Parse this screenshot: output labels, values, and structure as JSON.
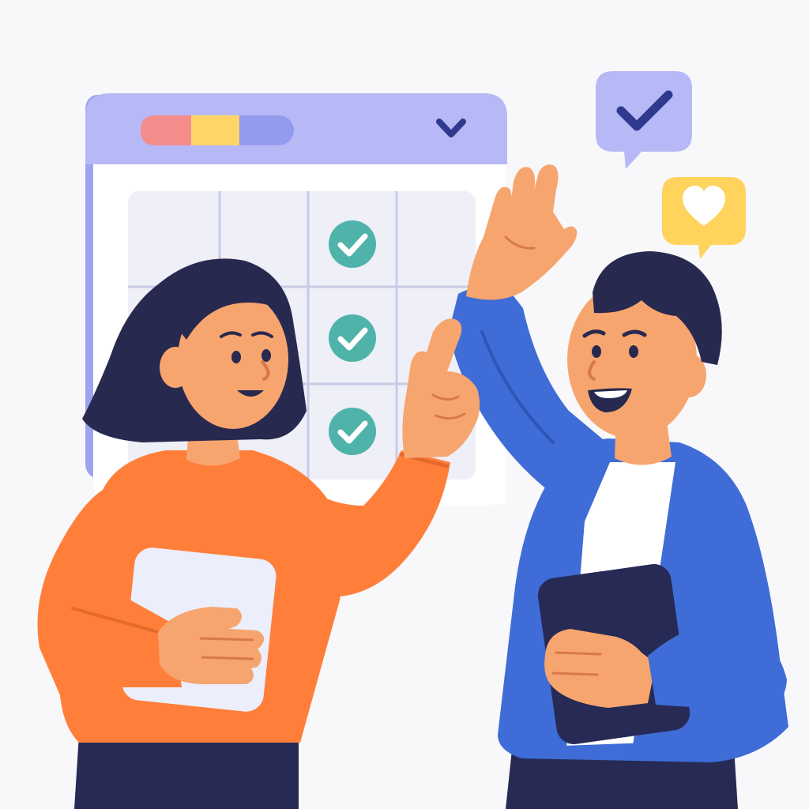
{
  "colors": {
    "background": "#f8f8fb",
    "window_frame": "#b6b8f5",
    "window_header": "#b7b9f6",
    "grid_panel": "#eeeff7",
    "grid_line": "#c9cbe6",
    "check_badge": "#4fb3aa",
    "pill_red": "#f48c8c",
    "pill_yellow": "#ffd56a",
    "pill_blue": "#949bef",
    "bubble_purple": "#b7b9f6",
    "bubble_check": "#2f3a8f",
    "bubble_yellow": "#ffd35c",
    "woman_sweater": "#ff7f3a",
    "man_jacket": "#3f6cd6",
    "skin": "#f7a56f",
    "hair": "#28294f",
    "pants": "#262a55"
  },
  "icons": {
    "window_heart": "heart-icon",
    "calendar_check": "check-icon",
    "bubble_check": "check-icon",
    "bubble_heart": "heart-icon"
  },
  "calendar": {
    "columns": 4,
    "rows": 3,
    "checked_cells": [
      {
        "row": 1,
        "col": 3
      },
      {
        "row": 2,
        "col": 3
      },
      {
        "row": 3,
        "col": 3
      }
    ]
  }
}
